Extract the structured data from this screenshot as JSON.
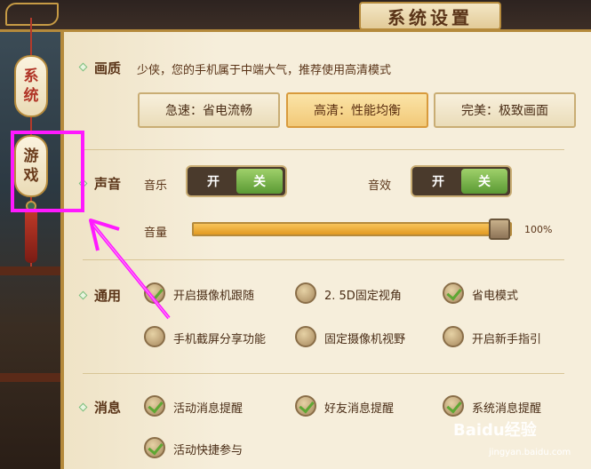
{
  "window": {
    "title": "系统设置"
  },
  "side_tabs": [
    {
      "label_line1": "系",
      "label_line2": "统"
    },
    {
      "label_line1": "游",
      "label_line2": "戏"
    }
  ],
  "quality": {
    "label": "画质",
    "description": "少侠，您的手机属于中端大气，推荐使用高清模式",
    "options": [
      "急速：省电流畅",
      "高清：性能均衡",
      "完美：极致画面"
    ],
    "selected": "高清：性能均衡"
  },
  "sound": {
    "label": "声音",
    "music": {
      "label": "音乐",
      "on": "开",
      "off": "关",
      "active": "关"
    },
    "effects": {
      "label": "音效",
      "on": "开",
      "off": "关",
      "active": "关"
    },
    "volume": {
      "label": "音量",
      "value_text": "100%",
      "value": 1.0
    }
  },
  "general": {
    "label": "通用",
    "options": [
      {
        "label": "开启摄像机跟随",
        "checked": true
      },
      {
        "label": "2. 5D固定视角",
        "checked": false
      },
      {
        "label": "省电模式",
        "checked": true
      },
      {
        "label": "手机截屏分享功能",
        "checked": false
      },
      {
        "label": "固定摄像机视野",
        "checked": false
      },
      {
        "label": "开启新手指引",
        "checked": false
      }
    ]
  },
  "messages": {
    "label": "消息",
    "options": [
      {
        "label": "活动消息提醒",
        "checked": true
      },
      {
        "label": "好友消息提醒",
        "checked": true
      },
      {
        "label": "系统消息提醒",
        "checked": true
      },
      {
        "label": "活动快捷参与",
        "checked": true
      }
    ]
  },
  "watermark": {
    "brand": "Baidu经验",
    "url": "jingyan.baidu.com"
  },
  "colors": {
    "accent": "#b58a3c",
    "check_green": "#5ea734",
    "highlight": "#ff19ff"
  }
}
